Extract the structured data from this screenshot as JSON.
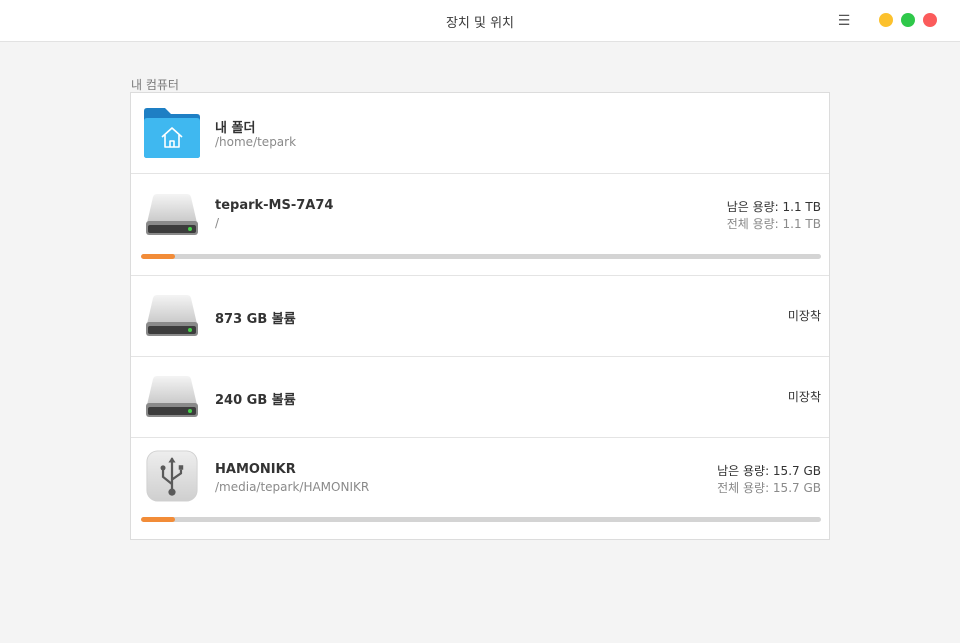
{
  "window": {
    "title": "장치 및 위치",
    "menu_icon": "hamburger-menu-icon",
    "buttons": [
      "minimize",
      "maximize",
      "close"
    ],
    "colors": {
      "minimize": "#fcc12d",
      "maximize": "#2fc84a",
      "close": "#fb5b5b",
      "accent": "#f28c38"
    }
  },
  "section": {
    "label": "내 컴퓨터"
  },
  "items": [
    {
      "type": "home-folder",
      "icon": "home-folder-icon",
      "name": "내 폴더",
      "path": "/home/tepark"
    },
    {
      "type": "drive",
      "icon": "hard-drive-icon",
      "name": "tepark-MS-7A74",
      "path": "/",
      "free": "남은 용량: 1.1 TB",
      "total": "전체 용량: 1.1 TB",
      "usage_fraction": 0.05
    },
    {
      "type": "drive",
      "icon": "hard-drive-icon",
      "name": "873 GB 볼륨",
      "status": "미장착"
    },
    {
      "type": "drive",
      "icon": "hard-drive-icon",
      "name": "240 GB 볼륨",
      "status": "미장착"
    },
    {
      "type": "usb",
      "icon": "usb-icon",
      "name": "HAMONIKR",
      "path": "/media/tepark/HAMONIKR",
      "free": "남은 용량: 15.7 GB",
      "total": "전체 용량: 15.7 GB",
      "usage_fraction": 0.05
    }
  ]
}
